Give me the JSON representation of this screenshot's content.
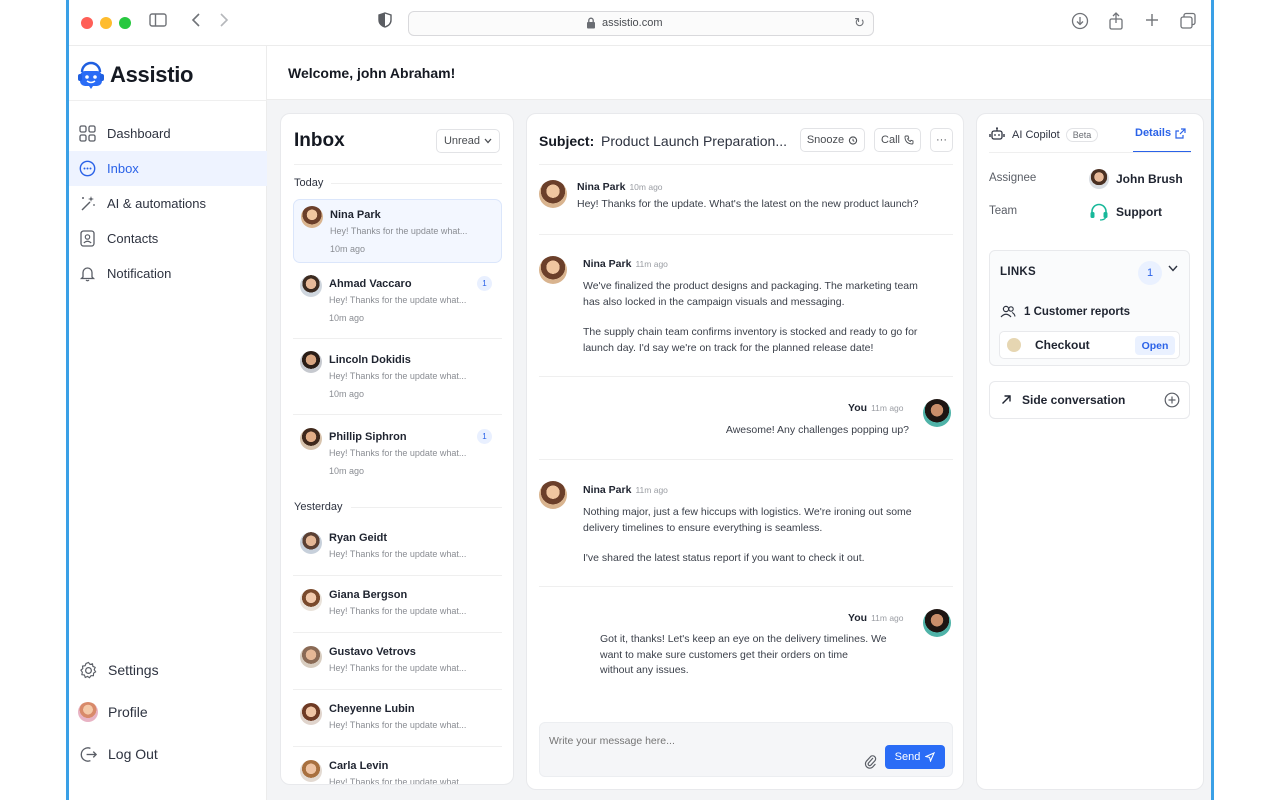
{
  "browser": {
    "url": "assistio.com"
  },
  "app": {
    "name": "Assistio",
    "welcome": "Welcome, john Abraham!"
  },
  "sidebar": {
    "items": [
      {
        "label": "Dashboard",
        "icon": "grid-icon"
      },
      {
        "label": "Inbox",
        "icon": "chat-bubble-icon",
        "active": true
      },
      {
        "label": "AI & automations",
        "icon": "magic-wand-icon"
      },
      {
        "label": "Contacts",
        "icon": "contact-card-icon"
      },
      {
        "label": "Notification",
        "icon": "bell-icon"
      }
    ],
    "bottom": [
      {
        "label": "Settings",
        "icon": "gear-icon"
      },
      {
        "label": "Profile",
        "icon": "avatar"
      },
      {
        "label": "Log Out",
        "icon": "logout-icon"
      }
    ]
  },
  "inbox": {
    "title": "Inbox",
    "filter": "Unread",
    "groups": [
      "Today",
      "Yesterday"
    ],
    "conversations": [
      {
        "name": "Nina Park",
        "preview": "Hey! Thanks for the update what...",
        "time": "10m ago",
        "badge": "",
        "selected": true
      },
      {
        "name": "Ahmad Vaccaro",
        "preview": "Hey! Thanks for the update what...",
        "time": "10m ago",
        "badge": "1"
      },
      {
        "name": "Lincoln Dokidis",
        "preview": "Hey! Thanks for the update what...",
        "time": "10m ago",
        "badge": ""
      },
      {
        "name": "Phillip Siphron",
        "preview": "Hey! Thanks for the update what...",
        "time": "10m ago",
        "badge": "1"
      },
      {
        "name": "Ryan Geidt",
        "preview": "Hey! Thanks for the update what...",
        "time": "",
        "badge": ""
      },
      {
        "name": "Giana Bergson",
        "preview": "Hey! Thanks for the update what...",
        "time": "",
        "badge": ""
      },
      {
        "name": "Gustavo Vetrovs",
        "preview": "Hey! Thanks for the update what...",
        "time": "",
        "badge": ""
      },
      {
        "name": "Cheyenne Lubin",
        "preview": "Hey! Thanks for the update what...",
        "time": "",
        "badge": ""
      },
      {
        "name": "Carla Levin",
        "preview": "Hey! Thanks for the update what...",
        "time": "",
        "badge": ""
      }
    ]
  },
  "chat": {
    "subject_label": "Subject:",
    "subject": "Product Launch Preparation...",
    "snooze_label": "Snooze",
    "call_label": "Call",
    "more_label": "···",
    "messages": [
      {
        "sender": "Nina Park",
        "time": "10m ago",
        "lines": [
          "Hey! Thanks for the update. What's the latest on the new product launch?"
        ]
      },
      {
        "sender": "Nina Park",
        "time": "11m ago",
        "lines": [
          "We've finalized the product designs and packaging. The marketing team",
          "has also locked in the campaign visuals and messaging.",
          "",
          "The supply chain team confirms inventory is stocked and ready to go for",
          "launch day. I'd say we're on track for the planned release date!"
        ]
      },
      {
        "sender": "You",
        "time": "11m ago",
        "lines": [
          "Awesome! Any challenges popping up?"
        ]
      },
      {
        "sender": "Nina Park",
        "time": "11m ago",
        "lines": [
          "Nothing major, just a few hiccups with logistics. We're ironing out some",
          "delivery timelines to ensure everything is seamless.",
          "",
          "I've shared the latest status report if you want to check it out."
        ]
      },
      {
        "sender": "You",
        "time": "11m ago",
        "lines": [
          "Got it, thanks! Let's keep an eye on the delivery timelines. We",
          "want to make sure customers get their orders on time",
          "without any issues."
        ]
      }
    ],
    "composer_placeholder": "Write your message here...",
    "send_label": "Send"
  },
  "copilot": {
    "title": "AI Copilot",
    "beta": "Beta",
    "details_tab": "Details",
    "assignee_label": "Assignee",
    "assignee": "John Brush",
    "team_label": "Team",
    "team": "Support",
    "links_title": "LINKS",
    "links_count": "1",
    "customer_reports": "1 Customer reports",
    "checkout_label": "Checkout",
    "open_label": "Open",
    "side_conversation": "Side conversation"
  },
  "colors": {
    "accent": "#2a62e8",
    "send": "#2a6cf6",
    "team_icon": "#18b89a"
  }
}
